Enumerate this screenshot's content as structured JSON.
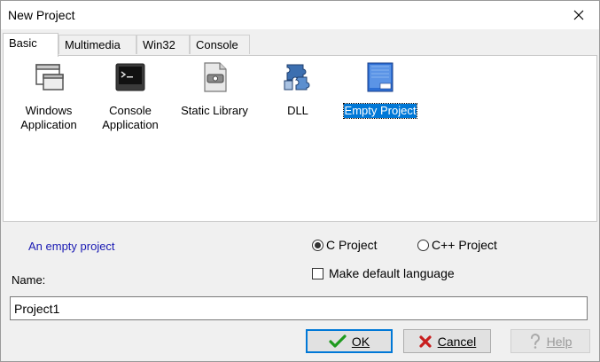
{
  "window": {
    "title": "New Project"
  },
  "tabs": [
    "Basic",
    "Multimedia",
    "Win32",
    "Console"
  ],
  "items": [
    {
      "line1": "Windows",
      "line2": "Application",
      "icon": "windows-app-icon"
    },
    {
      "line1": "Console",
      "line2": "Application",
      "icon": "console-app-icon"
    },
    {
      "line1": "Static Library",
      "line2": "",
      "icon": "static-library-icon"
    },
    {
      "line1": "DLL",
      "line2": "",
      "icon": "dll-icon"
    },
    {
      "line1": "Empty Project",
      "line2": "",
      "icon": "empty-project-icon",
      "selected": true
    }
  ],
  "description": "An empty project",
  "language": {
    "c_label": "C Project",
    "cpp_label": "C++ Project",
    "selected": "C Project"
  },
  "default_language": {
    "label": "Make default language",
    "checked": false
  },
  "name": {
    "label": "Name:",
    "value": "Project1"
  },
  "buttons": {
    "ok": "OK",
    "cancel": "Cancel",
    "help": "Help"
  },
  "colors": {
    "accent": "#0078d7",
    "description": "#1a1ab3"
  }
}
